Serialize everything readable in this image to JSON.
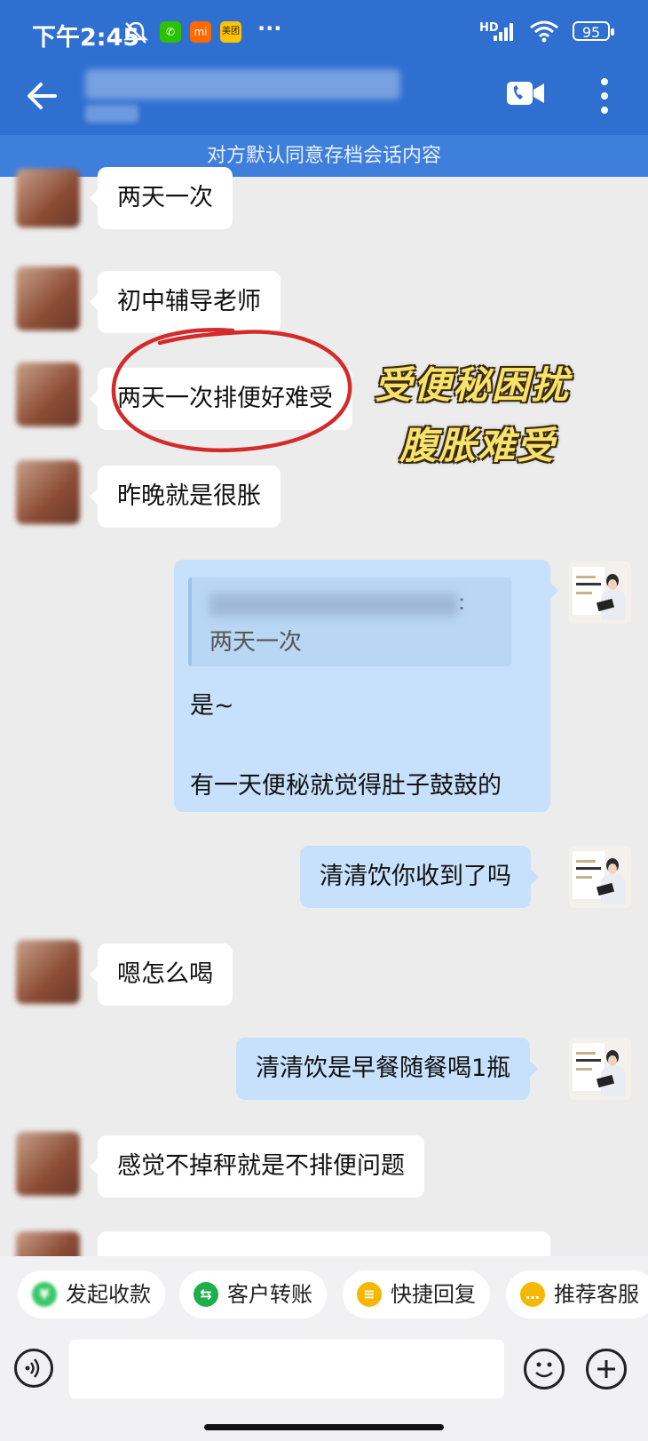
{
  "status_bar": {
    "time": "下午2:45",
    "app_icons": [
      {
        "name": "wechat-icon",
        "color": "#2dc100",
        "glyph": "✆"
      },
      {
        "name": "mi-icon",
        "color": "#ff6900",
        "glyph": "mi"
      },
      {
        "name": "meituan-icon",
        "color": "#ffc300",
        "glyph": "美团"
      }
    ],
    "more": "···",
    "signal": "HD",
    "battery": "95"
  },
  "header": {
    "accent_color": "#2f6fd0"
  },
  "notice": "对方默认同意存档会话内容",
  "messages": {
    "m1": "两天一次",
    "m2": "初中辅导老师",
    "m3": "两天一次排便好难受",
    "m4": "昨晚就是很胀",
    "quote_text": "两天一次",
    "quote_colon": ":",
    "reply_1": "是~",
    "reply_2": "有一天便秘就觉得肚子鼓鼓的",
    "m6": "清清饮你收到了吗",
    "m7": "嗯怎么喝",
    "m8": "清清饮是早餐随餐喝1瓶",
    "m9": "感觉不掉秤就是不排便问题"
  },
  "annotation": {
    "line1": "受便秘困扰",
    "line2": "腹胀难受",
    "circle_color": "#d42a2a",
    "text_color": "#f7e26b"
  },
  "toolbar": {
    "items": [
      {
        "label": "发起收款",
        "icon": "payment-icon",
        "color": "#3cc76a"
      },
      {
        "label": "客户转账",
        "icon": "transfer-icon",
        "color": "#1fae4b"
      },
      {
        "label": "快捷回复",
        "icon": "quick-reply-icon",
        "color": "#f5b800"
      },
      {
        "label": "推荐客服",
        "icon": "recommend-icon",
        "color": "#f5b800"
      }
    ]
  }
}
